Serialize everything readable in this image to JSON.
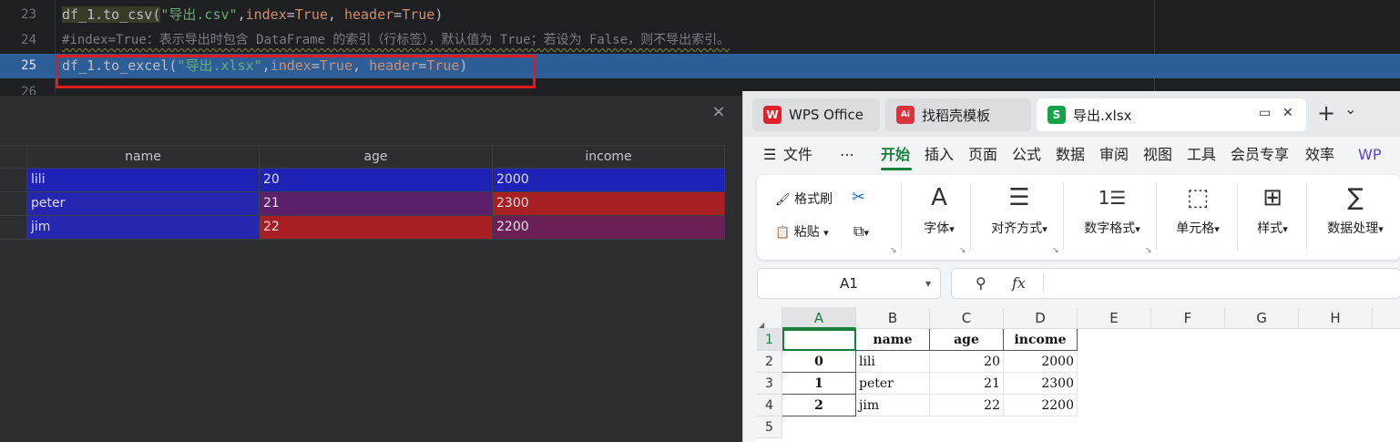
{
  "editor": {
    "lines": [
      {
        "num": "23",
        "t1": "df_1.to_csv(",
        "t2": "\"导出.csv\"",
        "t3": ",",
        "t4": "index",
        "t5": "=",
        "t6": "True",
        "t7": ", ",
        "t8": "header",
        "t9": "=",
        "t10": "True",
        "t11": ")"
      },
      {
        "num": "24",
        "comment": "#index=True：表示导出时包含 DataFrame 的索引（行标签），默认值为 True；若设为 False，则不导出索引。"
      },
      {
        "num": "25",
        "t1": "df_1.to_excel(",
        "t2": "\"导出.xlsx\"",
        "t3": ",",
        "t4": "index",
        "t5": "=",
        "t6": "True",
        "t7": ", ",
        "t8": "header",
        "t9": "=",
        "t10": "True",
        "t11": ")"
      },
      {
        "num": "26"
      }
    ]
  },
  "viewer": {
    "close_icon": "×",
    "columns": [
      "name",
      "age",
      "income"
    ],
    "rows": [
      {
        "name": "lili",
        "age": "20",
        "income": "2000"
      },
      {
        "name": "peter",
        "age": "21",
        "income": "2300"
      },
      {
        "name": "jim",
        "age": "22",
        "income": "2200"
      }
    ],
    "colors": {
      "lili": [
        "#1f22b6",
        "#1f22b6",
        "#1f22b6"
      ],
      "peter": [
        "#2626b0",
        "#5c1f6a",
        "#a71f22"
      ],
      "jim": [
        "#2626b0",
        "#a71f22",
        "#6a1f55"
      ]
    }
  },
  "wps": {
    "tabs": [
      {
        "label": "WPS Office",
        "icon": "W"
      },
      {
        "label": "找稻壳模板",
        "icon": "Ai"
      },
      {
        "label": "导出.xlsx",
        "icon": "S"
      }
    ],
    "tab_controls": {
      "monitor": "▭",
      "close": "✕",
      "plus": "+",
      "more": "⌄"
    },
    "menu": {
      "file_icon": "☰",
      "file": "文件",
      "dots": "⋯",
      "items": [
        "开始",
        "插入",
        "页面",
        "公式",
        "数据",
        "审阅",
        "视图",
        "工具",
        "会员专享",
        "效率"
      ],
      "wps_ai": "WP"
    },
    "ribbon": {
      "format_painter": "格式刷",
      "paste": "粘贴",
      "paste_arrow": "▾",
      "copy_arrow": "▾",
      "font": "字体",
      "align": "对齐方式",
      "number_format": "数字格式",
      "cell": "单元格",
      "style": "样式",
      "data_process": "数据处理",
      "dropdown": "▾",
      "corner": "↘",
      "glyph_font": "A",
      "glyph_align": "☰",
      "glyph_number": "1☰",
      "glyph_cell": "⬚",
      "glyph_style": "⊞",
      "glyph_sum": "∑",
      "glyph_cut": "✂",
      "glyph_brush": "🖌",
      "glyph_clip": "📋",
      "glyph_copy": "⧉"
    },
    "formula": {
      "cell_ref": "A1",
      "zoom_icon": "⚲",
      "fx": "fx"
    },
    "sheet": {
      "cols": [
        "A",
        "B",
        "C",
        "D",
        "E",
        "F",
        "G",
        "H"
      ],
      "rows": [
        "1",
        "2",
        "3",
        "4",
        "5"
      ],
      "header": [
        "",
        "name",
        "age",
        "income"
      ],
      "data": [
        [
          "0",
          "lili",
          "20",
          "2000"
        ],
        [
          "1",
          "peter",
          "21",
          "2300"
        ],
        [
          "2",
          "jim",
          "22",
          "2200"
        ]
      ]
    },
    "accent": "#1a7f3c"
  }
}
